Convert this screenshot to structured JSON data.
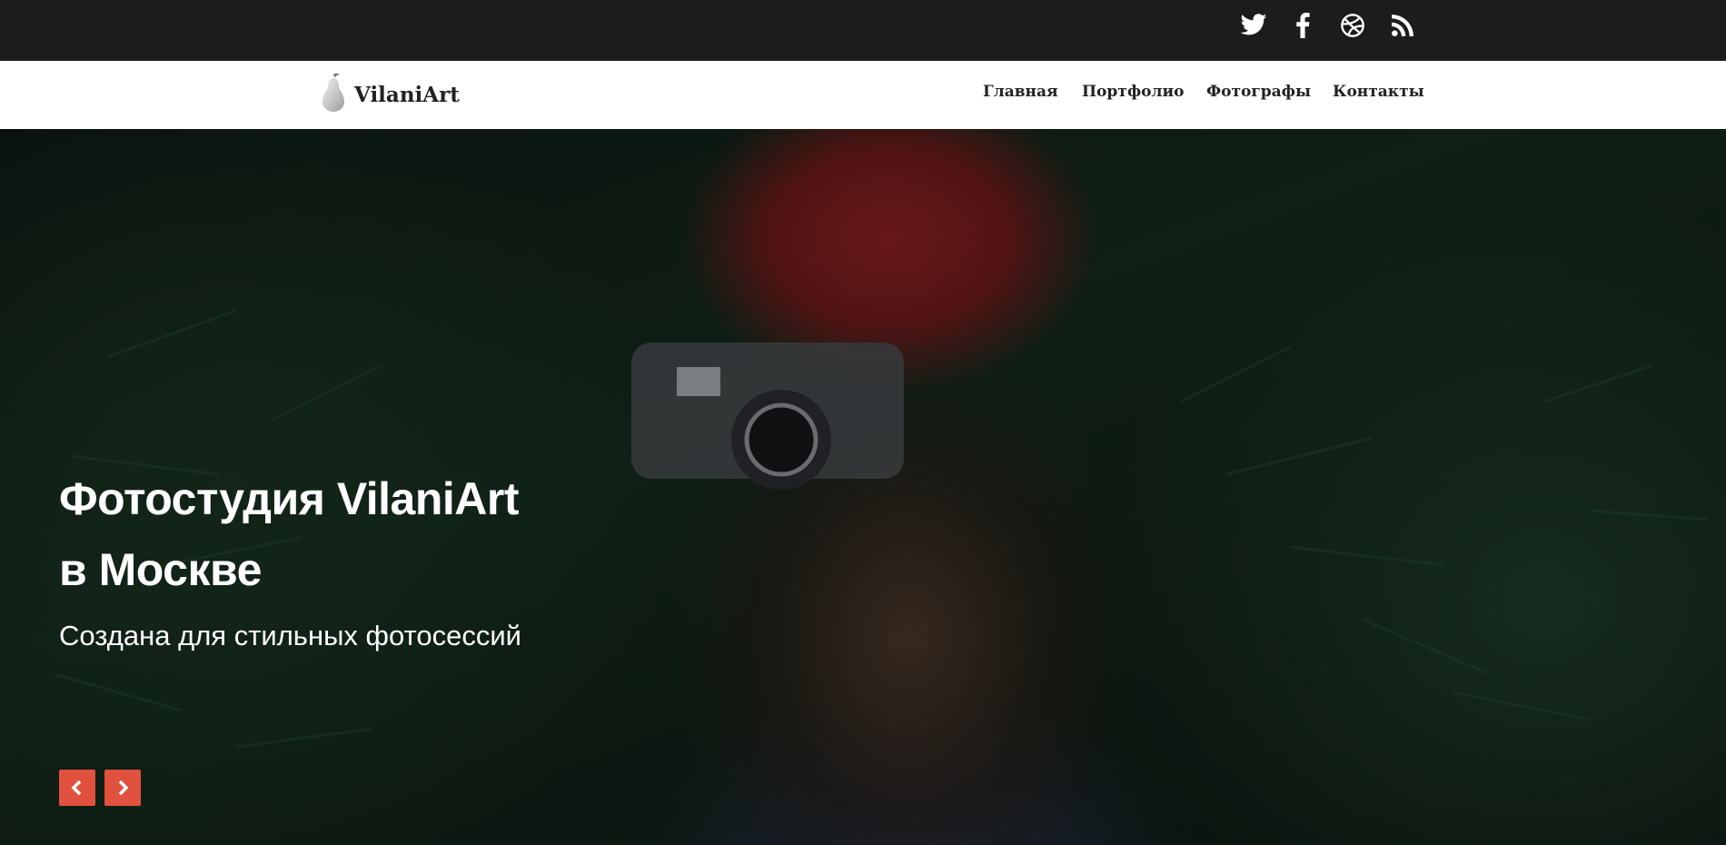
{
  "topbar": {
    "social": [
      {
        "icon": "twitter-icon"
      },
      {
        "icon": "facebook-icon"
      },
      {
        "icon": "dribbble-icon"
      },
      {
        "icon": "rss-icon"
      }
    ]
  },
  "navbar": {
    "logo_text": "VilaniArt",
    "logo_icon": "pear-icon",
    "items": [
      "Главная",
      "Портфолио",
      "Фотографы",
      "Контакты"
    ]
  },
  "hero": {
    "title_line1": "Фотостудия VilaniArt",
    "title_line2": "в Москве",
    "subtitle": "Создана для стильных фотосессий",
    "prev_icon": "chevron-left-icon",
    "next_icon": "chevron-right-icon"
  },
  "colors": {
    "topbar_bg": "#1c1c1c",
    "navbar_bg": "#ffffff",
    "accent": "#e0513e"
  }
}
